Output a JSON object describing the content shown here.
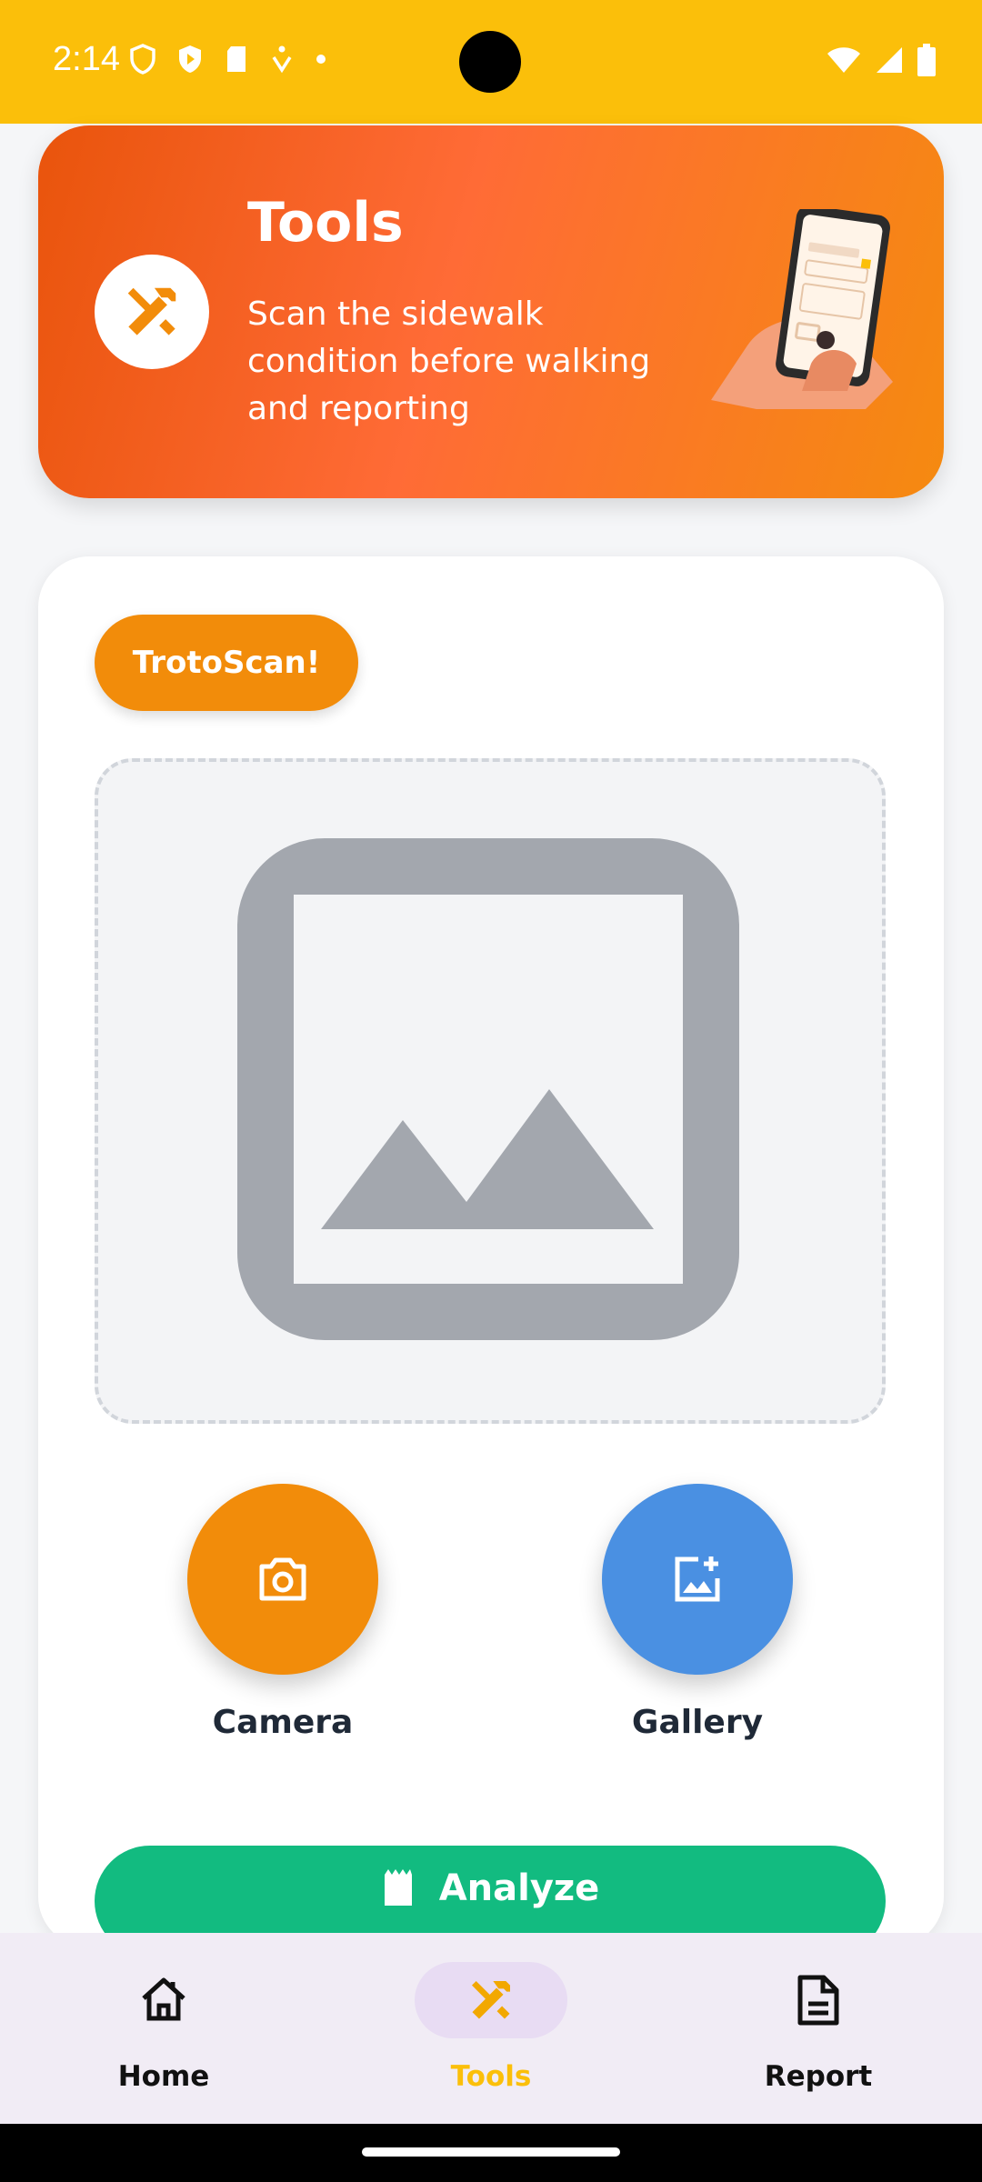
{
  "status_bar": {
    "time": "2:14",
    "background_color": "#fbbf0a"
  },
  "header": {
    "title": "Tools",
    "subtitle": "Scan the sidewalk condition before walking and reporting",
    "icon": "tools-icon"
  },
  "scan": {
    "badge_label": "TrotoScan!",
    "placeholder_icon": "image-placeholder-icon"
  },
  "actions": {
    "camera_label": "Camera",
    "gallery_label": "Gallery",
    "analyze_label": "Analyze"
  },
  "bottom_nav": {
    "items": [
      {
        "label": "Home",
        "icon": "home-icon",
        "active": false
      },
      {
        "label": "Tools",
        "icon": "tools-icon",
        "active": true
      },
      {
        "label": "Report",
        "icon": "report-icon",
        "active": false
      }
    ]
  },
  "colors": {
    "accent_orange": "#f28c0a",
    "gallery_blue": "#4a90e2",
    "analyze_green": "#12bb80",
    "active_nav": "#fbbf0a"
  }
}
